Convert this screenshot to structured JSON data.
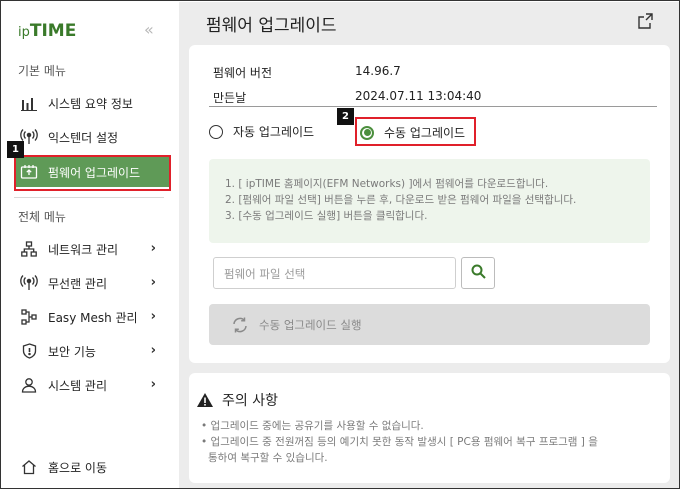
{
  "brand": {
    "logo_ip": "ip",
    "logo_time": "TIME",
    "collapse_glyph": "«"
  },
  "sidebar": {
    "basic_menu_label": "기본 메뉴",
    "basic_items": [
      {
        "label": "시스템 요약 정보",
        "icon": "bar-chart-icon"
      },
      {
        "label": "익스텐더 설정",
        "icon": "signal-icon"
      },
      {
        "label": "펌웨어 업그레이드",
        "icon": "firmware-icon",
        "active": true
      }
    ],
    "all_menu_label": "전체 메뉴",
    "all_items": [
      {
        "label": "네트워크 관리",
        "icon": "network-icon"
      },
      {
        "label": "무선랜 관리",
        "icon": "wireless-icon"
      },
      {
        "label": "Easy Mesh 관리",
        "icon": "mesh-icon"
      },
      {
        "label": "보안 기능",
        "icon": "shield-icon"
      },
      {
        "label": "시스템 관리",
        "icon": "user-icon"
      }
    ],
    "home_label": "홈으로 이동"
  },
  "badges": {
    "badge1": "1",
    "badge2": "2"
  },
  "main": {
    "title": "펌웨어 업그레이드",
    "firmware_version_label": "펌웨어 버전",
    "firmware_version_value": "14.96.7",
    "build_date_label": "만든날",
    "build_date_value": "2024.07.11 13:04:40",
    "auto_upgrade_label": "자동 업그레이드",
    "manual_upgrade_label": "수동 업그레이드",
    "selected_mode": "manual",
    "instructions": [
      "1. [ ipTIME 홈페이지(EFM Networks) ]에서 펌웨어를 다운로드합니다.",
      "2. [펌웨어 파일 선택] 버튼을 누른 후, 다운로드 받은 펌웨어 파일을 선택합니다.",
      "3. [수동 업그레이드 실행] 버튼을 클릭합니다."
    ],
    "file_input_placeholder": "펌웨어 파일 선택",
    "run_button_label": "수동 업그레이드 실행"
  },
  "caution": {
    "title": "주의 사항",
    "lines": [
      "• 업그레이드 중에는 공유기를 사용할 수 없습니다.",
      "• 업그레이드 중 전원꺼짐 등의 예기치 못한 동작 발생시 [ PC용 펌웨어 복구 프로그램 ] 을",
      "통하여 복구할 수 있습니다."
    ]
  },
  "colors": {
    "accent": "#5f9a57",
    "highlight": "#e0202a",
    "instruction_bg": "#eef5ec"
  }
}
